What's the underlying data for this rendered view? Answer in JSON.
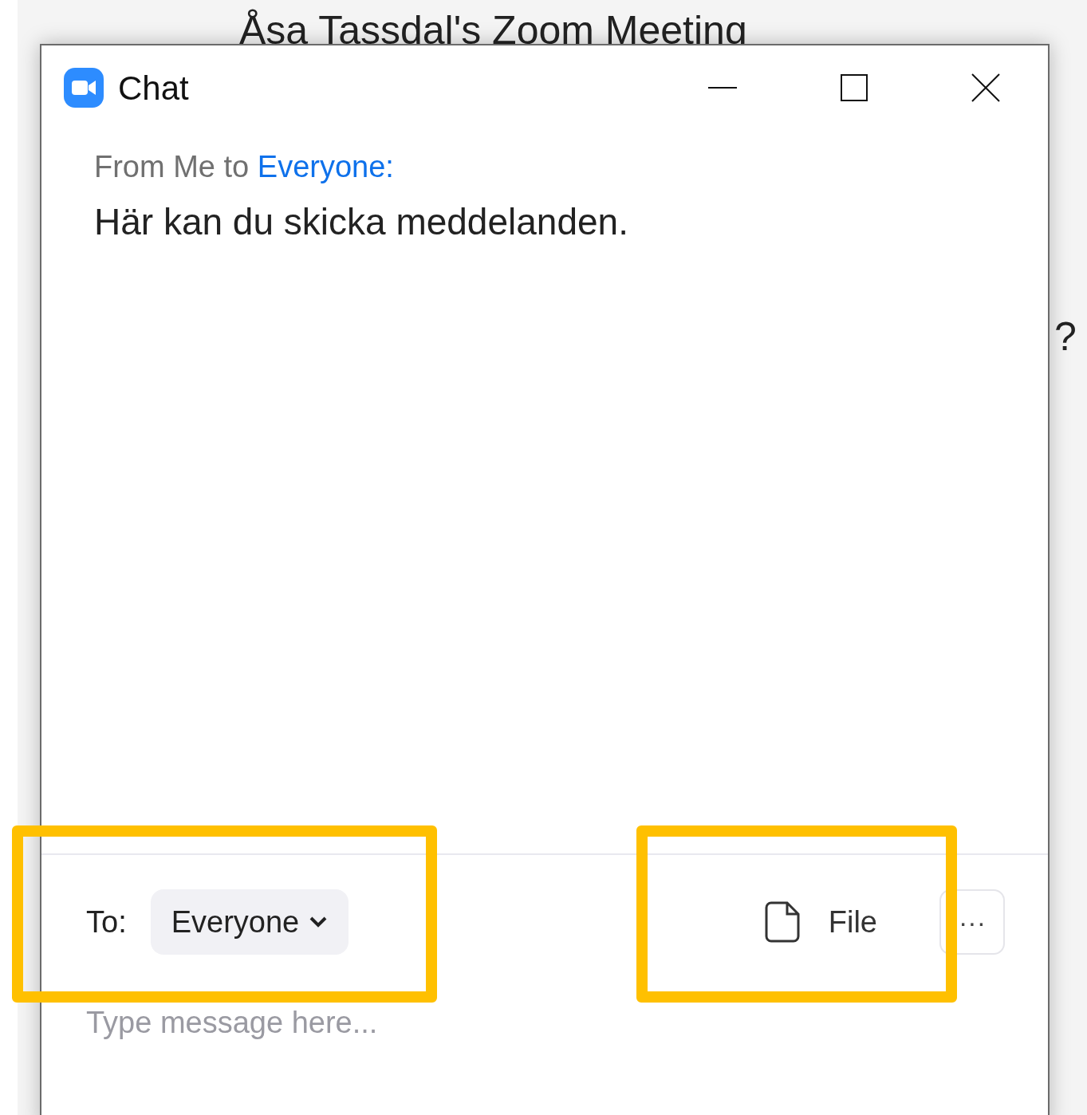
{
  "background": {
    "meeting_title": "Åsa Tassdal's Zoom Meeting",
    "edge_text": "?"
  },
  "window": {
    "title": "Chat"
  },
  "messages": [
    {
      "sender_prefix": "From Me to",
      "recipient": "Everyone:",
      "text": "Här kan du skicka meddelanden."
    }
  ],
  "composer": {
    "to_label": "To:",
    "recipient": "Everyone",
    "file_label": "File",
    "more_label": "···",
    "placeholder": "Type message here..."
  }
}
